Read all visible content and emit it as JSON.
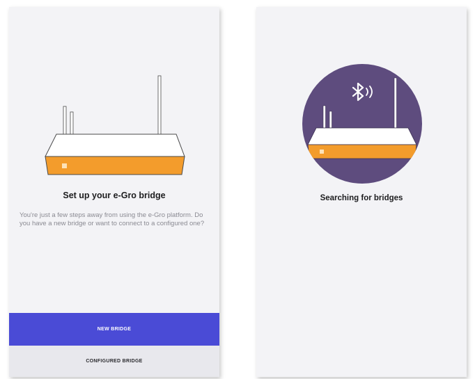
{
  "colors": {
    "accent": "#4a4bd6",
    "router_orange": "#f39c2c",
    "circle_purple": "#5e4c7e",
    "screen_bg": "#f3f3f6"
  },
  "setup_screen": {
    "illustration_icon": "router-icon",
    "title": "Set up your e-Gro bridge",
    "description": "You're just a few steps away from using the e-Gro platform. Do you have a new bridge or want to connect to a configured one?",
    "new_bridge_label": "NEW BRIDGE",
    "configured_bridge_label": "CONFIGURED BRIDGE"
  },
  "search_screen": {
    "illustration_icon": "bluetooth-searching-icon",
    "title": "Searching for bridges"
  }
}
